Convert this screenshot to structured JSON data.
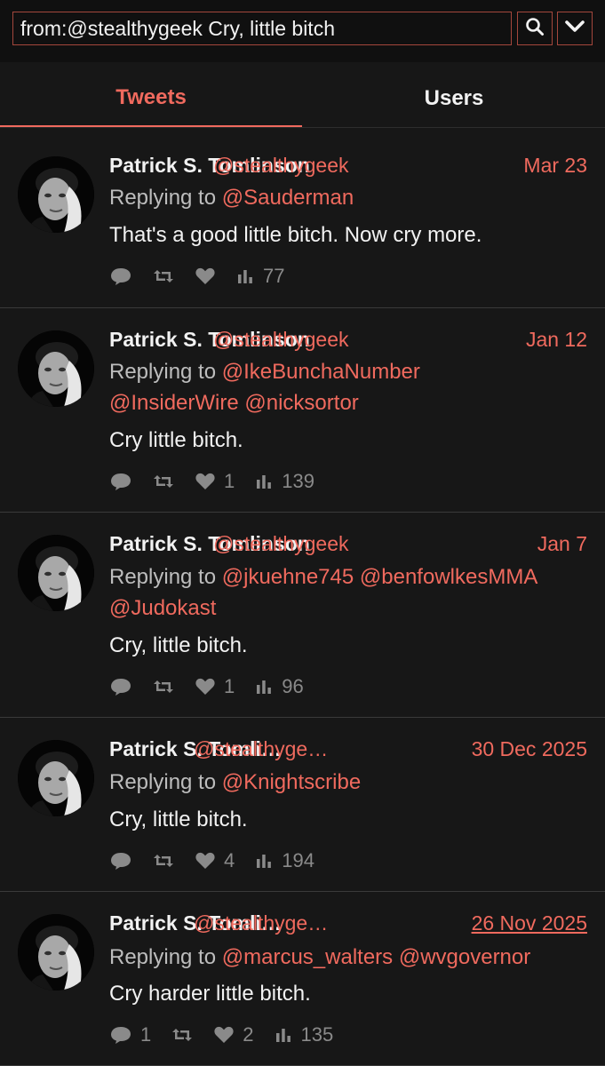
{
  "search": {
    "query": "from:@stealthygeek Cry, little bitch"
  },
  "tabs": [
    {
      "label": "Tweets",
      "active": true
    },
    {
      "label": "Users",
      "active": false
    }
  ],
  "colors": {
    "accent": "#f06a5e",
    "background": "#171717",
    "text": "#f2f2f2",
    "muted": "#8a8a8a"
  },
  "tweets": [
    {
      "name": "Patrick S. Tomlinson",
      "handle": "@stealthygeek",
      "date": "Mar 23",
      "reply_prefix": "Replying to",
      "reply_lines": [
        "@Sauderman"
      ],
      "text": "That's a good little bitch. Now cry more.",
      "stats": {
        "replies": "",
        "retweets": "",
        "likes": "",
        "views": "77"
      }
    },
    {
      "name": "Patrick S. Tomlinson",
      "handle": "@stealthygeek",
      "date": "Jan 12",
      "reply_prefix": "Replying to",
      "reply_lines": [
        "@IkeBunchaNumber",
        "@InsiderWire @nicksortor"
      ],
      "text": "Cry little bitch.",
      "stats": {
        "replies": "",
        "retweets": "",
        "likes": "1",
        "views": "139"
      }
    },
    {
      "name": "Patrick S. Tomlinson",
      "handle": "@stealthygeek",
      "date": "Jan 7",
      "reply_prefix": "Replying to",
      "reply_lines": [
        "@jkuehne745 @benfowlkesMMA",
        "@Judokast"
      ],
      "text": "Cry, little bitch.",
      "stats": {
        "replies": "",
        "retweets": "",
        "likes": "1",
        "views": "96"
      }
    },
    {
      "name": "Patrick S. Tomli…",
      "handle": "@stealthyge…",
      "date": "30 Dec 2025",
      "reply_prefix": "Replying to",
      "reply_lines": [
        "@Knightscribe"
      ],
      "text": "Cry, little bitch.",
      "stats": {
        "replies": "",
        "retweets": "",
        "likes": "4",
        "views": "194"
      }
    },
    {
      "name": "Patrick S. Tomli…",
      "handle": "@stealthyge…",
      "date": "26 Nov 2025",
      "reply_prefix": "Replying to",
      "reply_lines": [
        "@marcus_walters @wvgovernor"
      ],
      "text": "Cry harder little bitch.",
      "stats": {
        "replies": "1",
        "retweets": "",
        "likes": "2",
        "views": "135"
      }
    }
  ]
}
